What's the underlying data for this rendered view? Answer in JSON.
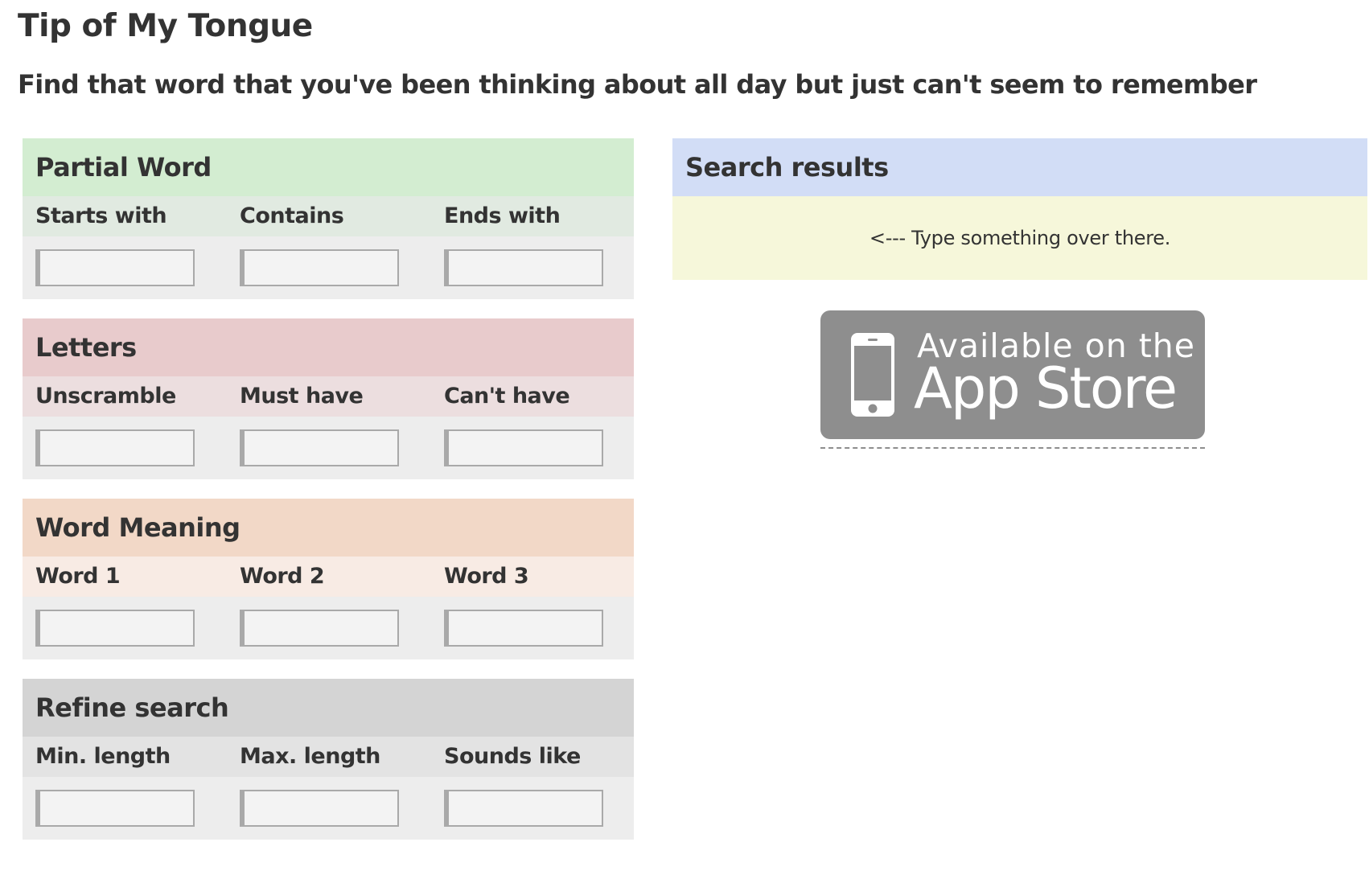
{
  "page": {
    "title": "Tip of My Tongue",
    "subtitle": "Find that word that you've been thinking about all day but just can't seem to remember"
  },
  "panels": [
    {
      "title": "Partial Word",
      "header_color": "#d3edd1",
      "label_color": "#e1eae1",
      "fields": [
        {
          "label": "Starts with",
          "value": ""
        },
        {
          "label": "Contains",
          "value": ""
        },
        {
          "label": "Ends with",
          "value": ""
        }
      ]
    },
    {
      "title": "Letters",
      "header_color": "#e8cbcc",
      "label_color": "#ecdedf",
      "fields": [
        {
          "label": "Unscramble",
          "value": ""
        },
        {
          "label": "Must have",
          "value": ""
        },
        {
          "label": "Can't have",
          "value": ""
        }
      ]
    },
    {
      "title": "Word Meaning",
      "header_color": "#f2d8c7",
      "label_color": "#f8ebe4",
      "fields": [
        {
          "label": "Word 1",
          "value": ""
        },
        {
          "label": "Word 2",
          "value": ""
        },
        {
          "label": "Word 3",
          "value": ""
        }
      ]
    },
    {
      "title": "Refine search",
      "header_color": "#d4d4d4",
      "label_color": "#e3e3e3",
      "fields": [
        {
          "label": "Min. length",
          "value": ""
        },
        {
          "label": "Max. length",
          "value": ""
        },
        {
          "label": "Sounds like",
          "value": ""
        }
      ]
    }
  ],
  "results": {
    "title": "Search results",
    "message": "<--- Type something over there."
  },
  "app_store": {
    "line1": "Available on the",
    "line2": "App Store",
    "icon": "phone-icon"
  }
}
